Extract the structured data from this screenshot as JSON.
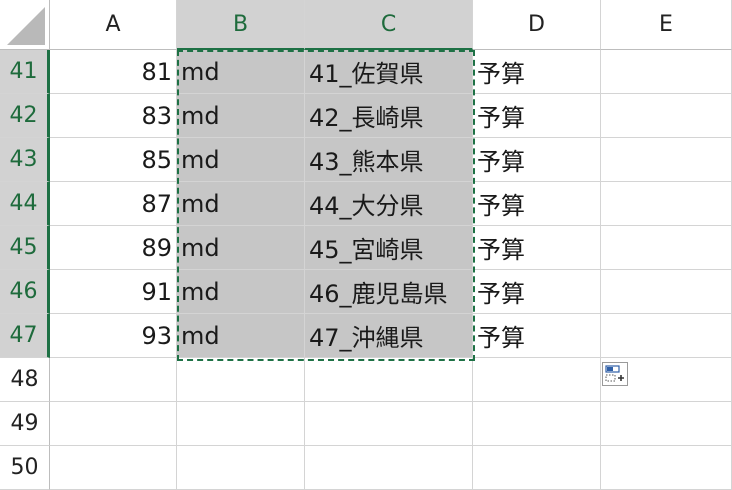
{
  "columns": [
    "A",
    "B",
    "C",
    "D",
    "E"
  ],
  "selected_columns": [
    "B",
    "C"
  ],
  "rows": [
    {
      "n": "41",
      "a": "81",
      "b": "md",
      "c": "41_佐賀県",
      "d": "予算",
      "e": ""
    },
    {
      "n": "42",
      "a": "83",
      "b": "md",
      "c": "42_長崎県",
      "d": "予算",
      "e": ""
    },
    {
      "n": "43",
      "a": "85",
      "b": "md",
      "c": "43_熊本県",
      "d": "予算",
      "e": ""
    },
    {
      "n": "44",
      "a": "87",
      "b": "md",
      "c": "44_大分県",
      "d": "予算",
      "e": ""
    },
    {
      "n": "45",
      "a": "89",
      "b": "md",
      "c": "45_宮崎県",
      "d": "予算",
      "e": ""
    },
    {
      "n": "46",
      "a": "91",
      "b": "md",
      "c": "46_鹿児島県",
      "d": "予算",
      "e": ""
    },
    {
      "n": "47",
      "a": "93",
      "b": "md",
      "c": "47_沖縄県",
      "d": "予算",
      "e": ""
    },
    {
      "n": "48",
      "a": "",
      "b": "",
      "c": "",
      "d": "",
      "e": ""
    },
    {
      "n": "49",
      "a": "",
      "b": "",
      "c": "",
      "d": "",
      "e": ""
    },
    {
      "n": "50",
      "a": "",
      "b": "",
      "c": "",
      "d": "",
      "e": ""
    }
  ],
  "selected_rows": [
    "41",
    "42",
    "43",
    "44",
    "45",
    "46",
    "47"
  ],
  "colors": {
    "selection_fill": "#c6c6c6",
    "header_selected": "#d2d2d2",
    "accent_green": "#1e7145",
    "gridline": "#d4d4d4"
  },
  "icons": {
    "corner": "select-all-triangle-icon",
    "paste_options": "paste-options-icon"
  }
}
